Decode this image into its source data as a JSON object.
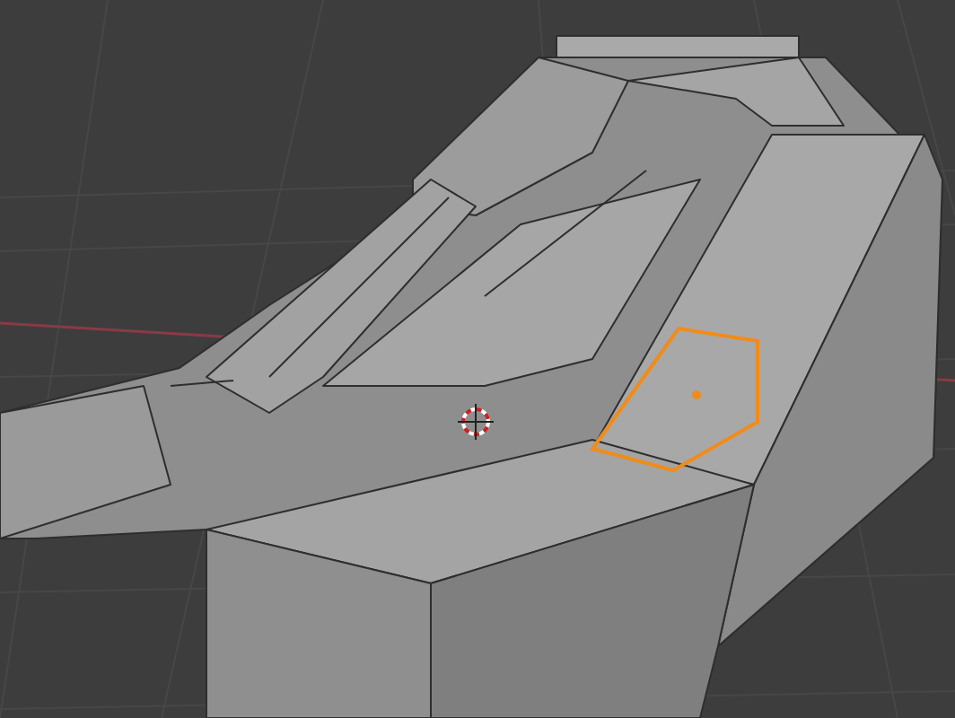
{
  "viewport": {
    "cursor_visible": true,
    "face_selected": true
  }
}
